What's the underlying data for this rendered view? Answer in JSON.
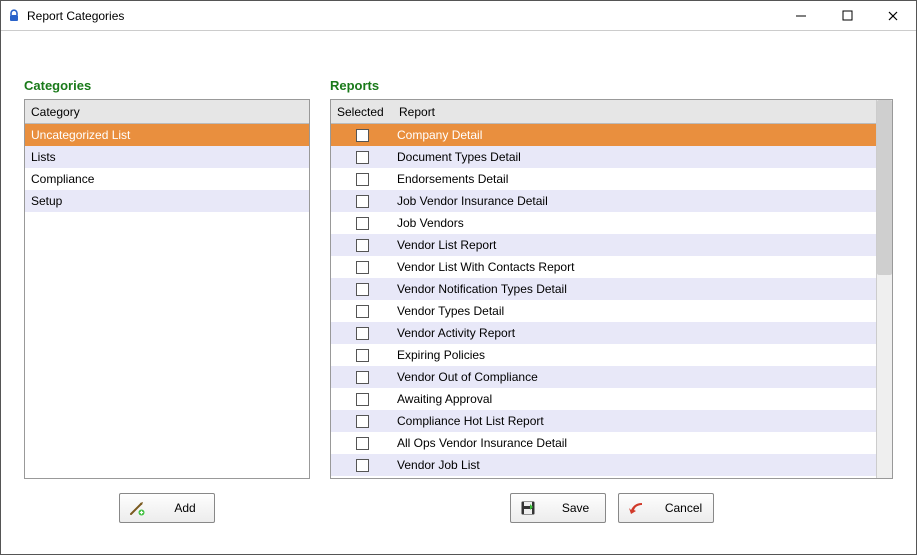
{
  "window": {
    "title": "Report Categories"
  },
  "labels": {
    "categories_title": "Categories",
    "reports_title": "Reports",
    "category_header": "Category",
    "selected_header": "Selected",
    "report_header": "Report",
    "add_button": "Add",
    "save_button": "Save",
    "cancel_button": "Cancel"
  },
  "categories": [
    {
      "name": "Uncategorized List",
      "selected": true
    },
    {
      "name": "Lists",
      "selected": false
    },
    {
      "name": "Compliance",
      "selected": false
    },
    {
      "name": "Setup",
      "selected": false
    }
  ],
  "reports": [
    {
      "name": "Company Detail",
      "selected": true,
      "checked": false
    },
    {
      "name": "Document Types Detail",
      "selected": false,
      "checked": false
    },
    {
      "name": "Endorsements Detail",
      "selected": false,
      "checked": false
    },
    {
      "name": "Job Vendor Insurance Detail",
      "selected": false,
      "checked": false
    },
    {
      "name": "Job Vendors",
      "selected": false,
      "checked": false
    },
    {
      "name": "Vendor List Report",
      "selected": false,
      "checked": false
    },
    {
      "name": "Vendor List With Contacts Report",
      "selected": false,
      "checked": false
    },
    {
      "name": "Vendor Notification Types Detail",
      "selected": false,
      "checked": false
    },
    {
      "name": "Vendor Types Detail",
      "selected": false,
      "checked": false
    },
    {
      "name": "Vendor Activity Report",
      "selected": false,
      "checked": false
    },
    {
      "name": "Expiring Policies",
      "selected": false,
      "checked": false
    },
    {
      "name": "Vendor Out of Compliance",
      "selected": false,
      "checked": false
    },
    {
      "name": "Awaiting Approval",
      "selected": false,
      "checked": false
    },
    {
      "name": "Compliance Hot List Report",
      "selected": false,
      "checked": false
    },
    {
      "name": "All Ops Vendor Insurance Detail",
      "selected": false,
      "checked": false
    },
    {
      "name": "Vendor Job List",
      "selected": false,
      "checked": false
    }
  ]
}
